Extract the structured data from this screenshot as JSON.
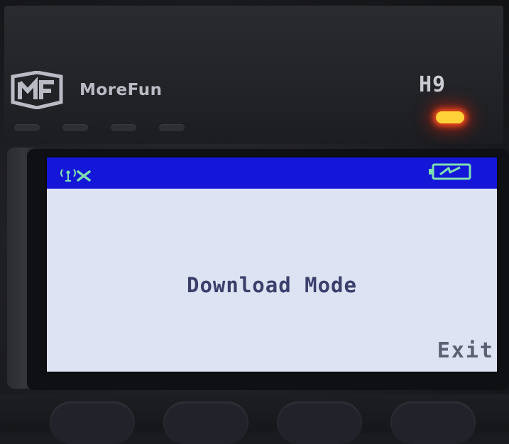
{
  "device": {
    "brand": "MoreFun",
    "model": "H9"
  },
  "screen": {
    "status_icons": {
      "signal": "no-signal-icon",
      "battery": "battery-charging-icon"
    },
    "message": "Download Mode",
    "softkey_right": "Exit"
  },
  "colors": {
    "status_bar": "#1416d8",
    "screen_background": "#dde3f3",
    "message_text": "#3a3f6b",
    "indicator_led": "#ff3a1a"
  }
}
